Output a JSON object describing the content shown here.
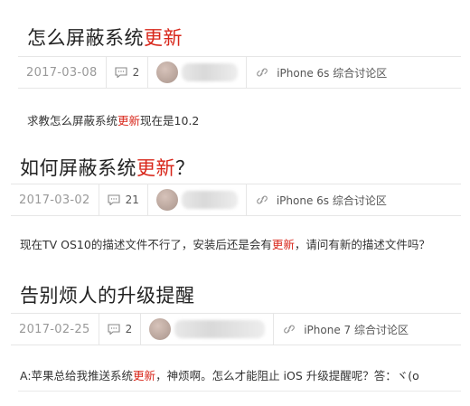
{
  "posts": [
    {
      "title_pre": "怎么屏蔽系统",
      "title_hl": "更新",
      "title_post": "",
      "date": "2017-03-08",
      "comments": "2",
      "forum": "iPhone 6s 综合讨论区",
      "body_pre": "求教怎么屏蔽系统",
      "body_hl": "更新",
      "body_post": "现在是10.2"
    },
    {
      "title_pre": "如何屏蔽系统",
      "title_hl": "更新",
      "title_post": "？",
      "date": "2017-03-02",
      "comments": "21",
      "forum": "iPhone 6s 综合讨论区",
      "body_pre": "现在TV OS10的描述文件不行了，安装后还是会有",
      "body_hl": "更新",
      "body_post": "，请问有新的描述文件吗？"
    },
    {
      "title_pre": "告别烦人的升级提醒",
      "title_hl": "",
      "title_post": "",
      "date": "2017-02-25",
      "comments": "2",
      "forum": "iPhone 7 综合讨论区",
      "body_pre": "A:苹果总给我推送系统",
      "body_hl": "更新",
      "body_post": "，神烦啊。怎么才能阻止 iOS 升级提醒呢？答：ヾ(o"
    }
  ],
  "colors": {
    "highlight": "#d8261a",
    "border": "#e6e6e6",
    "date": "#999999"
  },
  "icons": {
    "comment": "comment-bubble-icon",
    "forum": "link-icon"
  }
}
